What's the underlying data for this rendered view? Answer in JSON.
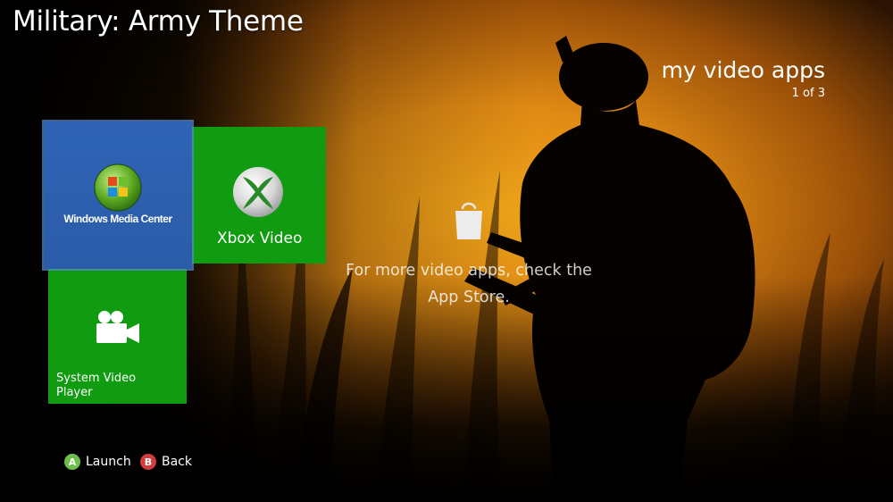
{
  "theme": {
    "title": "Military: Army Theme"
  },
  "section": {
    "title": "my video apps",
    "page_indicator": "1 of 3"
  },
  "tiles": [
    {
      "name": "windows-media-center",
      "label": "Windows Media Center",
      "color": "#2a5ca8",
      "selected": true
    },
    {
      "name": "xbox-video",
      "label": "Xbox Video",
      "color": "#109b10"
    },
    {
      "name": "system-video-player",
      "label": "System Video Player",
      "color": "#109b10"
    }
  ],
  "store": {
    "message": "For more video apps, check the App Store.",
    "icon": "shopping-bag-icon"
  },
  "hints": [
    {
      "button": "A",
      "label": "Launch",
      "color": "#6cc04a"
    },
    {
      "button": "B",
      "label": "Back",
      "color": "#d23c3c"
    }
  ]
}
